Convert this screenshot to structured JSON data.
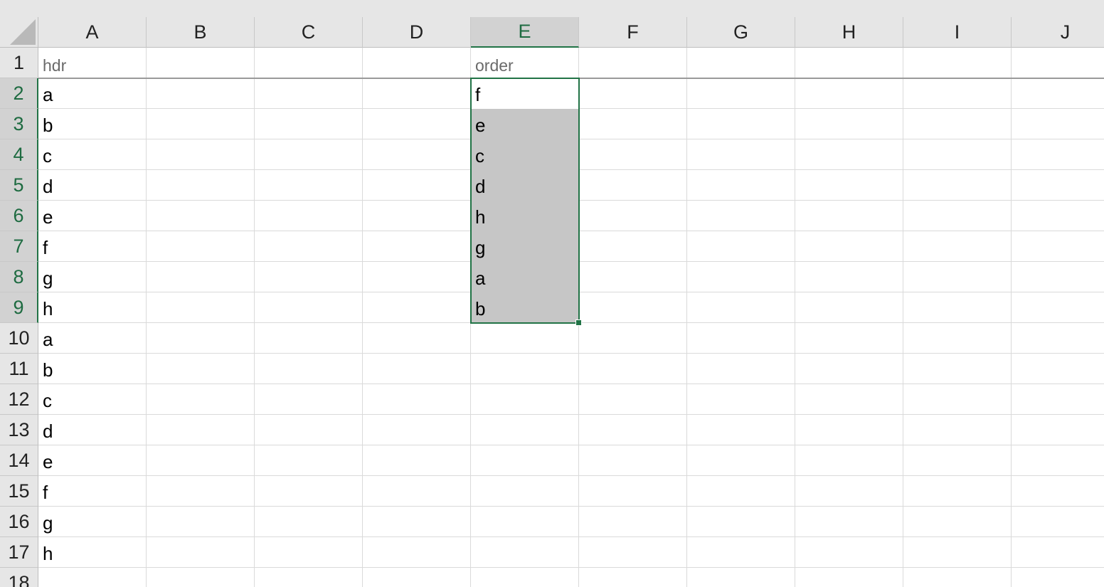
{
  "columns": [
    "A",
    "B",
    "C",
    "D",
    "E",
    "F",
    "G",
    "H",
    "I",
    "J"
  ],
  "active_column": "E",
  "rows": [
    "1",
    "2",
    "3",
    "4",
    "5",
    "6",
    "7",
    "8",
    "9",
    "10",
    "11",
    "12",
    "13",
    "14",
    "15",
    "16",
    "17",
    "18"
  ],
  "active_rows": [
    "2",
    "3",
    "4",
    "5",
    "6",
    "7",
    "8",
    "9"
  ],
  "cells": {
    "A1": "hdr",
    "A2": "a",
    "A3": "b",
    "A4": "c",
    "A5": "d",
    "A6": "e",
    "A7": "f",
    "A8": "g",
    "A9": "h",
    "A10": "a",
    "A11": "b",
    "A12": "c",
    "A13": "d",
    "A14": "e",
    "A15": "f",
    "A16": "g",
    "A17": "h",
    "E1": "order",
    "E2": "f",
    "E3": "e",
    "E4": "c",
    "E5": "d",
    "E6": "h",
    "E7": "g",
    "E8": "a",
    "E9": "b"
  },
  "selection": {
    "range": "E2:E9",
    "active_cell": "E2"
  },
  "colors": {
    "selection_border": "#217346",
    "selection_fill": "#c6c6c6",
    "header_bg": "#e6e6e6",
    "active_header_text": "#1e6b41"
  }
}
